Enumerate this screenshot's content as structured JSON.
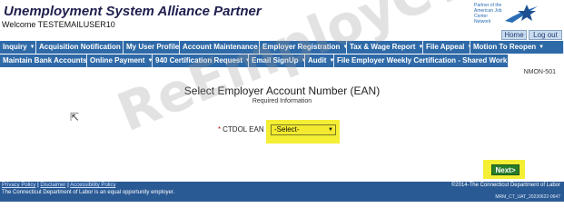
{
  "header": {
    "title": "Unemployment System Alliance Partner",
    "welcome": "Welcome TESTEMAILUSER10",
    "logo_text": "Partner of the American Job Center Network",
    "home": "Home",
    "logout": "Log out"
  },
  "nav_row1": [
    {
      "label": "Inquiry"
    },
    {
      "label": "Acquisition Notification"
    },
    {
      "label": "My User Profile"
    },
    {
      "label": "Account Maintenance"
    },
    {
      "label": "Employer Registration"
    },
    {
      "label": "Tax & Wage Report"
    },
    {
      "label": "File Appeal"
    },
    {
      "label": "Motion To Reopen"
    }
  ],
  "nav_row2": [
    {
      "label": "Maintain Bank Accounts"
    },
    {
      "label": "Online Payment"
    },
    {
      "label": "940 Certification Request"
    },
    {
      "label": "Email SignUp"
    },
    {
      "label": "Audit"
    },
    {
      "label": "File Employer Weekly Certification - Shared Work"
    }
  ],
  "main": {
    "screen_code": "NMON-501",
    "title": "Select Employer Account Number (EAN)",
    "required_note": "Required Information",
    "ean_label": "CTDOL EAN",
    "ean_selected": "-Select-",
    "next_button": "Next>"
  },
  "footer": {
    "privacy": "Privacy Policy",
    "disclaimer": "Disclaimer",
    "accessibility": "Accessibility Policy",
    "separator": "|",
    "eo_statement": "The Connecticut Department of Labor is an equal opportunity employer.",
    "copyright": "©2014-The Connecticut Department of Labor",
    "build": "MRM_CT_UAT_20230622-0647"
  },
  "watermark": "ReEmployCT.com",
  "colors": {
    "nav_bg": "#2f6aa8",
    "footer_bg": "#2a5a94",
    "highlight": "#f4ee34",
    "next_button": "#2a7d2a"
  }
}
